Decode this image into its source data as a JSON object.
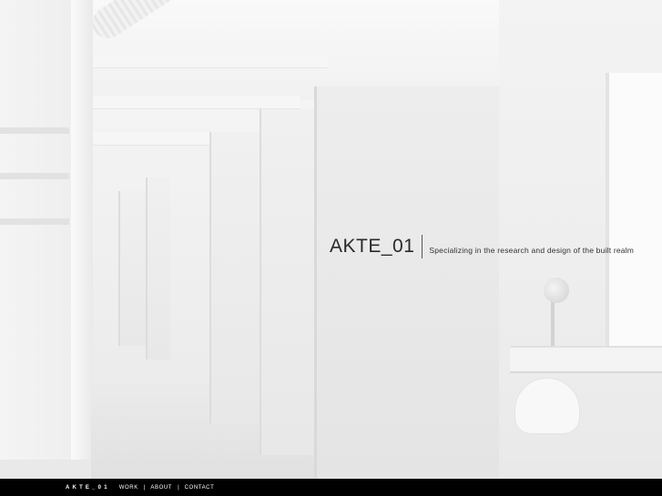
{
  "hero": {
    "logo": "AKTE_01",
    "tagline": "Specializing in the research and design of the built realm"
  },
  "footer": {
    "brand": "AKTE_01",
    "nav": [
      {
        "label": "WORK"
      },
      {
        "label": "ABOUT"
      },
      {
        "label": "CONTACT"
      }
    ],
    "separator": "|"
  },
  "colors": {
    "footer_background": "#000000",
    "footer_text": "#ffffff",
    "headline_text": "#2a2a2a"
  }
}
